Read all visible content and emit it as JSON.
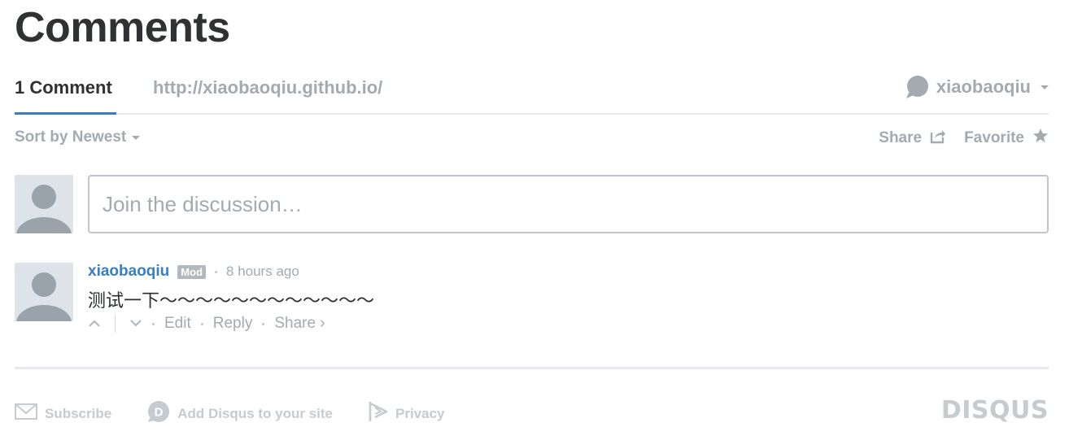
{
  "page": {
    "title": "Comments"
  },
  "nav": {
    "comment_count": "1 Comment",
    "site_url": "http://xiaobaoqiu.github.io/",
    "user_name": "xiaobaoqiu",
    "user_icon": "speech-bubble-icon"
  },
  "toolbar": {
    "sort_label": "Sort by Newest",
    "share_label": "Share",
    "favorite_label": "Favorite"
  },
  "compose": {
    "placeholder": "Join the discussion…"
  },
  "comment": {
    "author": "xiaobaoqiu",
    "badge": "Mod",
    "time": "8 hours ago",
    "body": "测试一下～～～～～～～～～～～～",
    "edit_label": "Edit",
    "reply_label": "Reply",
    "share_label": "Share ›"
  },
  "footer": {
    "subscribe_label": "Subscribe",
    "add_disqus_label": "Add Disqus to your site",
    "privacy_label": "Privacy",
    "logo_text": "DISQUS"
  },
  "colors": {
    "accent": "#3a7ec2",
    "muted_text": "#a3aab0",
    "heading": "#2f3133",
    "border": "#c2c6cc"
  }
}
